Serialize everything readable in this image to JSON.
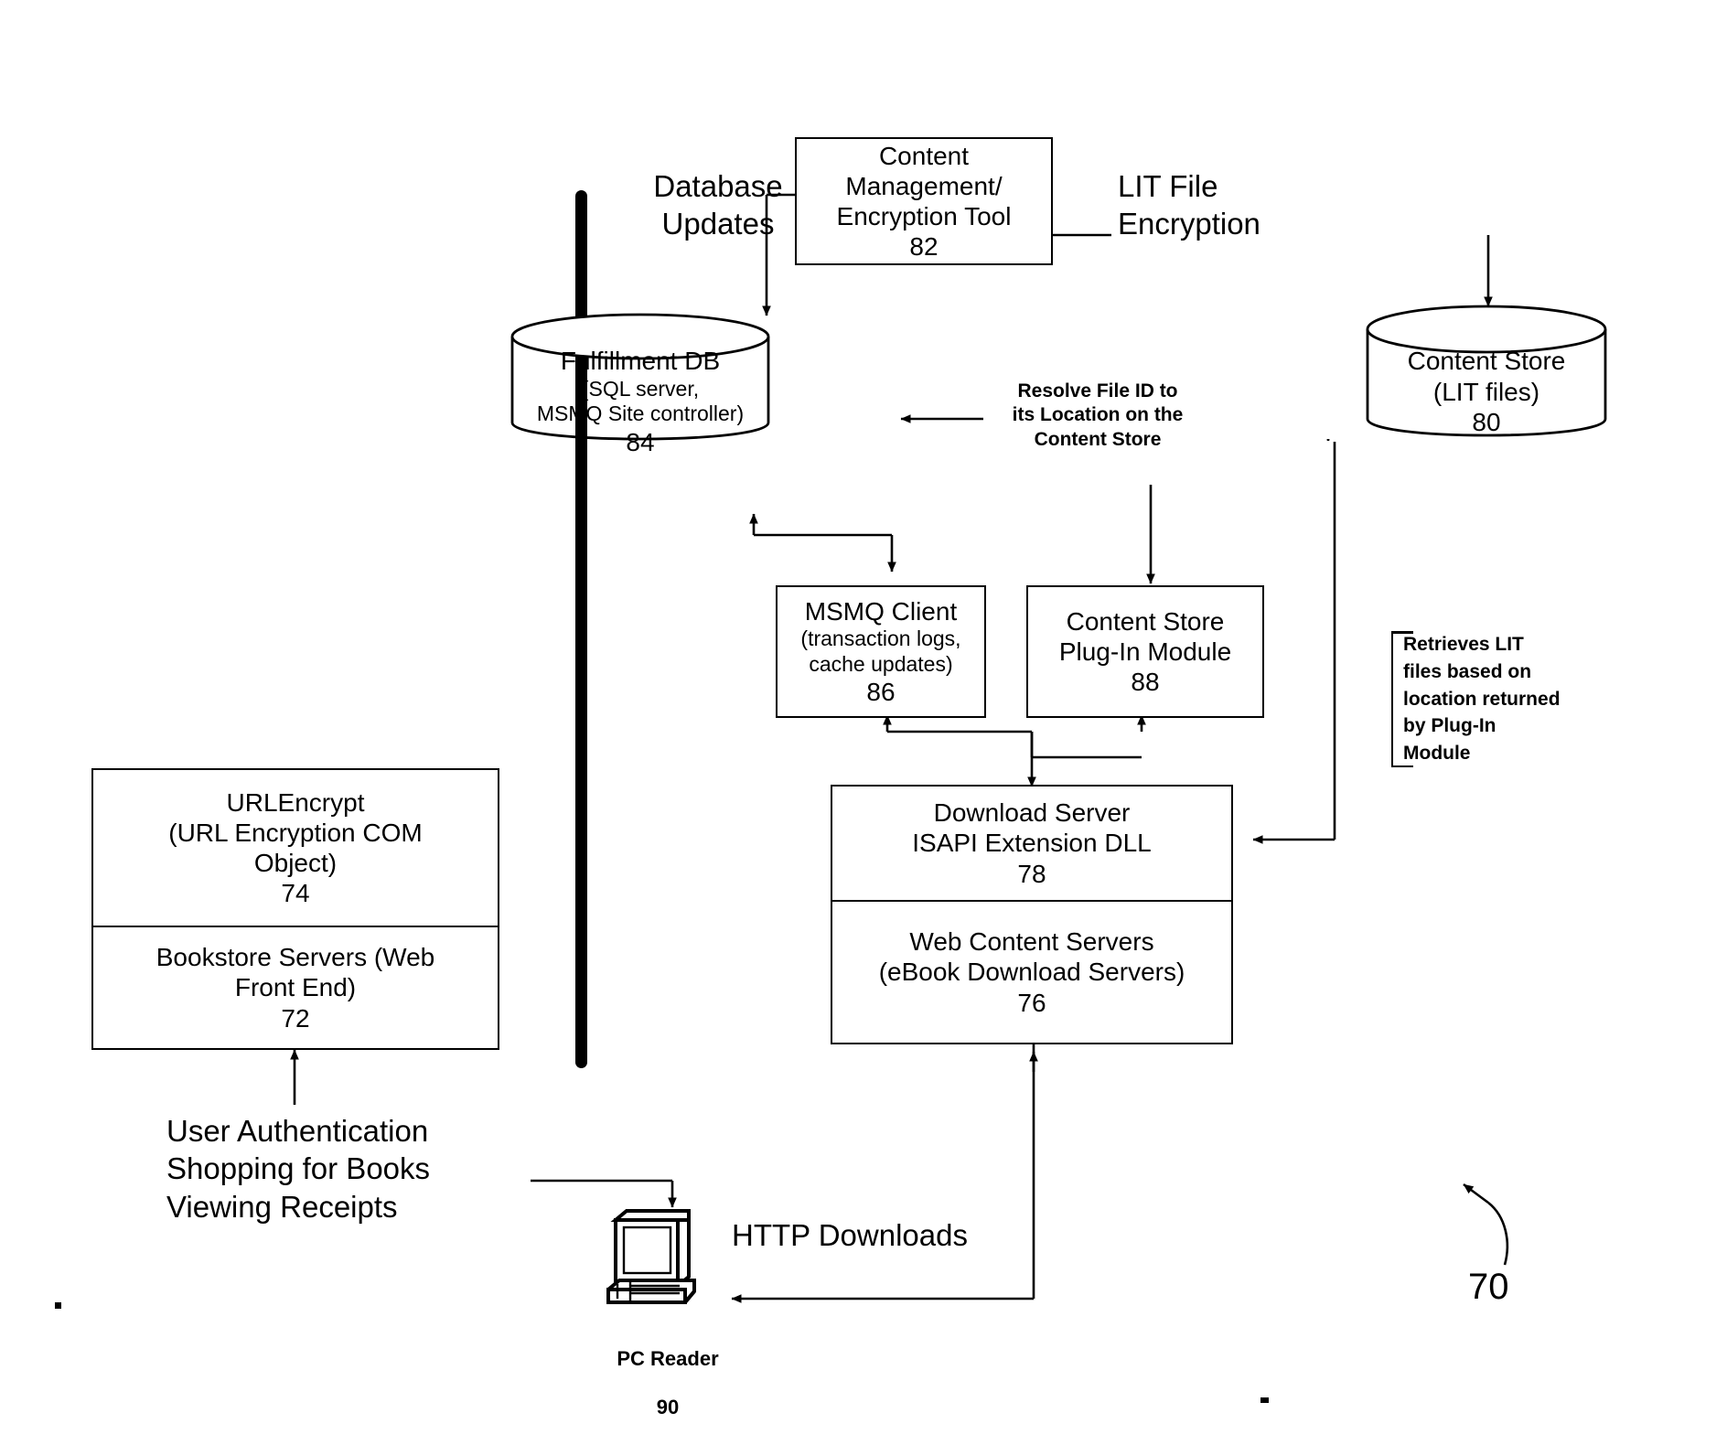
{
  "figure": {
    "number": "70",
    "title": ""
  },
  "nodes": {
    "content_management_tool": {
      "lines": "Content\nManagement/\nEncryption Tool",
      "ref": "82"
    },
    "fulfillment_db": {
      "title": "Fulfillment DB",
      "detail": "(SQL server,\nMSMQ Site controller)",
      "ref": "84"
    },
    "content_store": {
      "title": "Content Store",
      "detail": "(LIT files)",
      "ref": "80"
    },
    "msmq_client": {
      "title": "MSMQ Client",
      "detail": "(transaction logs,\ncache updates)",
      "ref": "86"
    },
    "content_store_plugin": {
      "title": "Content Store\nPlug-In Module",
      "ref": "88"
    },
    "download_server": {
      "title": "Download Server\nISAPI Extension DLL",
      "ref": "78"
    },
    "web_content_servers": {
      "title": "Web Content Servers\n(eBook Download Servers)",
      "ref": "76"
    },
    "url_encrypt": {
      "title": "URLEncrypt",
      "detail": "(URL Encryption COM\nObject)",
      "ref": "74"
    },
    "bookstore_servers": {
      "title": "Bookstore Servers (Web\nFront End)",
      "ref": "72"
    },
    "pc_reader": {
      "title": "PC Reader",
      "ref": "90"
    }
  },
  "annotations": {
    "database_updates": "Database\nUpdates",
    "lit_file_encryption": "LIT File\nEncryption",
    "resolve_file_id": "Resolve File ID to\nits Location on the\nContent Store",
    "retrieves_lit": "Retrieves LIT\nfiles based on\nlocation returned\nby Plug-In\nModule",
    "user_actions": "User Authentication\nShopping for Books\nViewing Receipts",
    "http_downloads": "HTTP Downloads"
  },
  "icons": {
    "pc_reader": "desktop-computer-icon",
    "database": "cylinder-database-icon",
    "arrow": "arrowhead-icon"
  },
  "colors": {
    "stroke": "#000000",
    "background": "#ffffff"
  }
}
